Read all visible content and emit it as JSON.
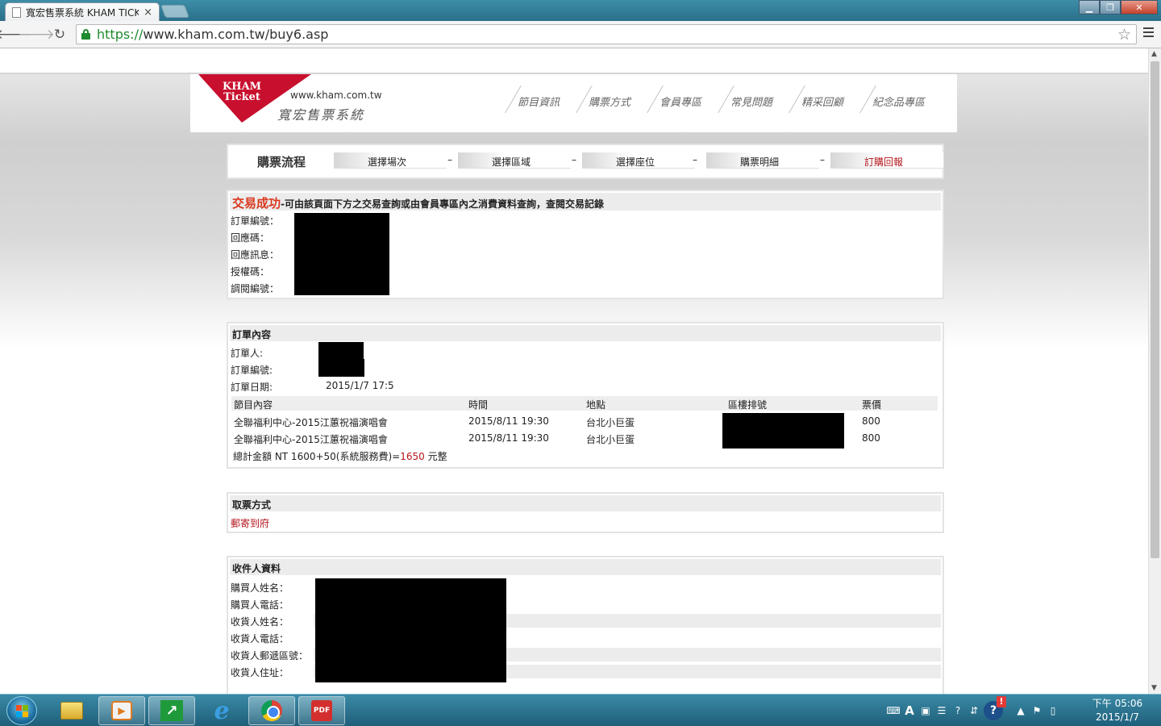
{
  "browser": {
    "tab_title": "寬宏售票系統 KHAM TICK",
    "tab_close": "×",
    "url_https": "https://",
    "url_rest": "www.kham.com.tw/buy6.asp",
    "star": "☆"
  },
  "site": {
    "logo_line1": "KHAM",
    "logo_line2": "Ticket",
    "url": "www.kham.com.tw",
    "name": "寬宏售票系統",
    "nav": [
      "節目資訊",
      "購票方式",
      "會員專區",
      "常見問題",
      "精采回顧",
      "紀念品專區"
    ]
  },
  "steps": {
    "title": "購票流程",
    "items": [
      "選擇場次",
      "選擇區域",
      "選擇座位",
      "購票明細",
      "訂購回報"
    ],
    "separator": "–",
    "active_index": 4
  },
  "success": {
    "headline": "交易成功",
    "note": "-可由該頁面下方之交易查詢或由會員專區內之消費資料查詢，查閱交易記錄",
    "labels": [
      "訂單編號：",
      "回應碼：",
      "回應訊息：",
      "授權碼：",
      "調閱編號："
    ]
  },
  "order": {
    "title": "訂單內容",
    "orderer_label": "訂單人:",
    "order_no_label": "訂單編號:",
    "date_label": "訂單日期:",
    "date_value": "2015/1/7 17:5",
    "columns": [
      "節目內容",
      "時間",
      "地點",
      "區樓排號",
      "票價"
    ],
    "rows": [
      {
        "program": "全聯福利中心-2015江蕙祝福演唱會",
        "time": "2015/8/11 19:30",
        "venue": "台北小巨蛋",
        "price": "800"
      },
      {
        "program": "全聯福利中心-2015江蕙祝福演唱會",
        "time": "2015/8/11 19:30",
        "venue": "台北小巨蛋",
        "price": "800"
      }
    ],
    "total_prefix": "總計金額 NT 1600+50(系統服務費)=",
    "total_amount": "1650",
    "total_suffix": " 元整"
  },
  "pickup": {
    "title": "取票方式",
    "value": "郵寄到府"
  },
  "recipient": {
    "title": "收件人資料",
    "labels": [
      "購買人姓名：",
      "購買人電話：",
      "收貨人姓名：",
      "收貨人電話：",
      "收貨人郵遞區號：",
      "收貨人住址："
    ]
  },
  "taskbar": {
    "clock_time": "下午 05:06",
    "clock_date": "2015/1/7",
    "pdf_label": "PDF"
  },
  "colors": {
    "accent_red": "#b3161c",
    "success_red": "#d9381e",
    "logo_red": "#c8102e"
  }
}
